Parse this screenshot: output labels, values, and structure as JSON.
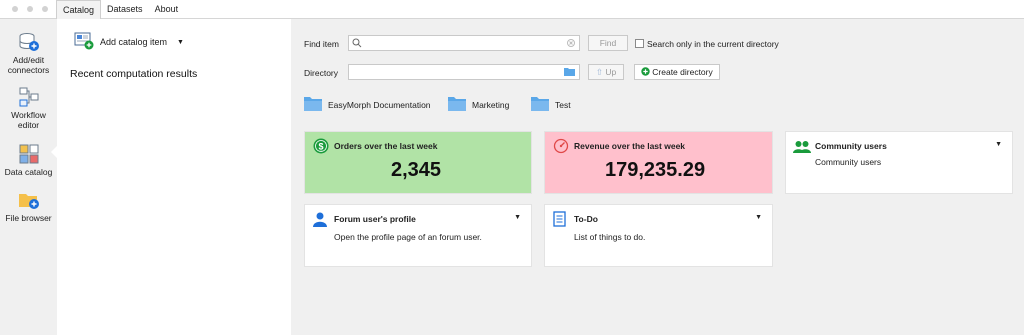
{
  "tabs": [
    {
      "label": "Catalog"
    },
    {
      "label": "Datasets"
    },
    {
      "label": "About"
    }
  ],
  "nav": {
    "items": [
      {
        "label_line1": "Add/edit",
        "label_line2": "connectors",
        "icon": "database-connector-icon"
      },
      {
        "label_line1": "Workflow",
        "label_line2": "editor",
        "icon": "workflow-icon"
      },
      {
        "label_line1": "Data catalog",
        "label_line2": "",
        "icon": "data-catalog-icon"
      },
      {
        "label_line1": "File browser",
        "label_line2": "",
        "icon": "folder-icon"
      }
    ],
    "active": "Data catalog"
  },
  "left_panel": {
    "add_catalog_item": "Add catalog item",
    "recent_heading": "Recent computation results"
  },
  "search": {
    "find_item_label": "Find item",
    "find_placeholder": "",
    "find_button": "Find",
    "only_current_dir": "Search only in the current directory",
    "directory_label": "Directory",
    "up_button": "Up",
    "create_directory_button": "Create directory"
  },
  "folders": [
    {
      "name": "EasyMorph Documentation"
    },
    {
      "name": "Marketing"
    },
    {
      "name": "Test"
    }
  ],
  "cards": {
    "orders": {
      "title": "Orders over the last week",
      "value": "2,345",
      "color": "#b1e3a6",
      "icon": "dollar-icon"
    },
    "revenue": {
      "title": "Revenue over the last week",
      "value": "179,235.29",
      "color": "#ffc0cc",
      "icon": "gauge-icon"
    },
    "community": {
      "title": "Community users",
      "description": "Community users",
      "icon": "users-icon"
    },
    "forum": {
      "title": "Forum user's profile",
      "description": "Open the profile page of an forum user.",
      "icon": "user-icon"
    },
    "todo": {
      "title": "To-Do",
      "description": "List of things to do.",
      "icon": "notebook-icon"
    }
  }
}
